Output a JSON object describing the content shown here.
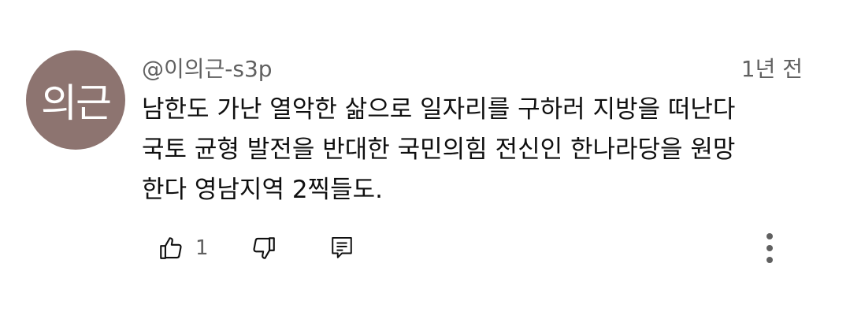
{
  "comment": {
    "avatar_text": "의근",
    "author": "@이의근-s3p",
    "time": "1년 전",
    "lines": [
      "남한도 가난 열악한 삶으로 일자리를 구하러 지방을 떠난다",
      "국토 균형 발전을 반대한 국민의힘 전신인 한나라당을 원망",
      "한다 영남지역 2찍들도."
    ],
    "like_count": "1"
  },
  "icons": {
    "like": "thumbs-up-icon",
    "dislike": "thumbs-down-icon",
    "reply": "reply-comment-icon",
    "more": "more-vertical-icon"
  },
  "colors": {
    "avatar_bg": "#8d7470",
    "meta_text": "#606060",
    "body_text": "#0f0f0f"
  }
}
